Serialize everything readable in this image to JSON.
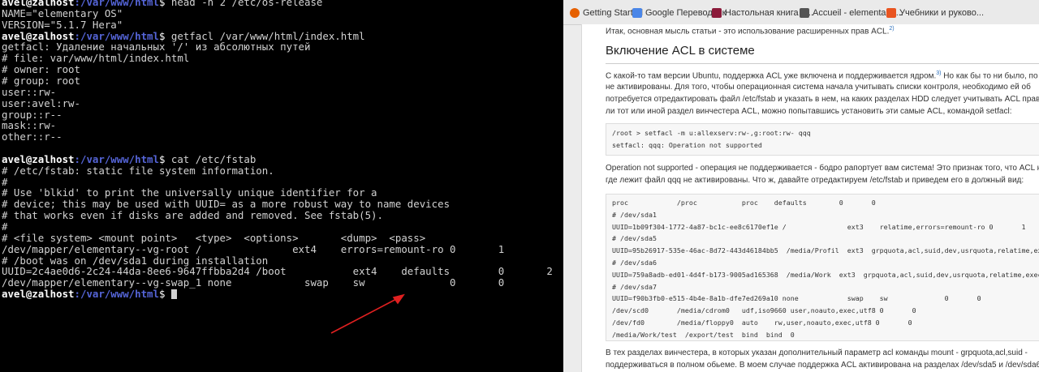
{
  "terminal": {
    "prompt_user": "avel@zalhost",
    "prompt_path": ":/var/www/html",
    "prompt_sym": "$ ",
    "lines": [
      {
        "type": "prompt",
        "cmd": "head -n 2 /etc/os-release"
      },
      {
        "type": "out",
        "text": "NAME=\"elementary OS\""
      },
      {
        "type": "out",
        "text": "VERSION=\"5.1.7 Hera\""
      },
      {
        "type": "prompt",
        "cmd": "getfacl /var/www/html/index.html"
      },
      {
        "type": "out",
        "text": "getfacl: Удаление начальных '/' из абсолютных путей"
      },
      {
        "type": "out",
        "text": "# file: var/www/html/index.html"
      },
      {
        "type": "out",
        "text": "# owner: root"
      },
      {
        "type": "out",
        "text": "# group: root"
      },
      {
        "type": "out",
        "text": "user::rw-"
      },
      {
        "type": "out",
        "text": "user:avel:rw-"
      },
      {
        "type": "out",
        "text": "group::r--"
      },
      {
        "type": "out",
        "text": "mask::rw-"
      },
      {
        "type": "out",
        "text": "other::r--"
      },
      {
        "type": "out",
        "text": ""
      },
      {
        "type": "prompt",
        "cmd": "cat /etc/fstab"
      },
      {
        "type": "out",
        "text": "# /etc/fstab: static file system information."
      },
      {
        "type": "out",
        "text": "#"
      },
      {
        "type": "out",
        "text": "# Use 'blkid' to print the universally unique identifier for a"
      },
      {
        "type": "out",
        "text": "# device; this may be used with UUID= as a more robust way to name devices"
      },
      {
        "type": "out",
        "text": "# that works even if disks are added and removed. See fstab(5)."
      },
      {
        "type": "out",
        "text": "#"
      },
      {
        "type": "out",
        "text": "# <file system> <mount point>   <type>  <options>       <dump>  <pass>"
      },
      {
        "type": "out",
        "text": "/dev/mapper/elementary--vg-root /               ext4    errors=remount-ro 0       1"
      },
      {
        "type": "out",
        "text": "# /boot was on /dev/sda1 during installation"
      },
      {
        "type": "out",
        "text": "UUID=2c4ae0d6-2c24-44da-8ee6-9647ffbba2d4 /boot           ext4    defaults        0       2"
      },
      {
        "type": "out",
        "text": "/dev/mapper/elementary--vg-swap_1 none            swap    sw              0       0"
      },
      {
        "type": "prompt",
        "cmd": ""
      }
    ]
  },
  "bookmarks": [
    {
      "label": "Getting Started",
      "color": "#e66000"
    },
    {
      "label": "Google Переводчик",
      "color": "#4a86e8"
    },
    {
      "label": "Настольная книга а...",
      "color": "#8b1a3a"
    },
    {
      "label": "Accueil - elementary ...",
      "color": "#555555"
    },
    {
      "label": "Учебники и руково...",
      "color": "#e95420"
    }
  ],
  "article": {
    "intro": "Итак, основная мысль статьи - это использование расширенных прав ACL.",
    "intro_sup": "2)",
    "heading": "Включение ACL в системе",
    "p1": [
      "С какой-то там версии Ubuntu, поддержка ACL уже включена и поддерживается ядром.",
      "не активированы. Для того, чтобы операционная система начала учитывать списки контроля, необходимо ей об",
      "потребуется отредактировать файл /etc/fstab и указать в нем, на каких разделах HDD следует учитывать ACL права. П",
      "ли тот или иной раздел винчестера ACL, можно попытавшись установить эти самые ACL, командой setfacl:"
    ],
    "p1_sup": "3)",
    "p1_tail": " Но как бы то ни было, по ум",
    "code1": [
      "/root > setfacl -m u:allexserv:rw-,g:root:rw- qqq",
      "setfacl: qqq: Operation not supported"
    ],
    "p2": [
      "Operation not supported - операция не поддерживается - бодро рапортует вам система! Это признак того, что ACL на э",
      "где лежит файл qqq не активированы. Что ж, давайте отредактируем /etc/fstab и приведем его в должный вид:"
    ],
    "code2": [
      "proc            /proc           proc    defaults        0       0",
      "# /dev/sda1",
      "UUID=1b09f304-1772-4a87-bc1c-ee8c6170ef1e /               ext3    relatime,errors=remount-ro 0       1",
      "# /dev/sda5",
      "UUID=95b26917-535e-46ac-8d72-443d46184bb5  /media/Profil  ext3  grpquota,acl,suid,dev,usrquota,relatime,exec  0  2",
      "# /dev/sda6",
      "UUID=759a8adb-ed01-4d4f-b173-9005ad165368  /media/Work  ext3  grpquota,acl,suid,dev,usrquota,relatime,exec  0  2",
      "# /dev/sda7",
      "UUID=f90b3fb0-e515-4b4e-8a1b-dfe7ed269a10 none            swap    sw              0       0",
      "/dev/scd0       /media/cdrom0   udf,iso9660 user,noauto,exec,utf8 0       0",
      "/dev/fd0        /media/floppy0  auto    rw,user,noauto,exec,utf8 0       0",
      "/media/Work/test  /export/test  bind  bind  0"
    ],
    "p3": [
      "В тех разделах винчестера, в которых указан дополнительный параметр acl команды mount - grpquota,acl,suid -",
      "поддерживаться в полном обьеме. В моем случае поддержка ACL активирована на разделах /dev/sda5 и /dev/sda6."
    ]
  },
  "colors": {
    "terminal_bg": "#000000",
    "prompt_path": "#5565d8",
    "annotation_arrow": "#e02020"
  }
}
